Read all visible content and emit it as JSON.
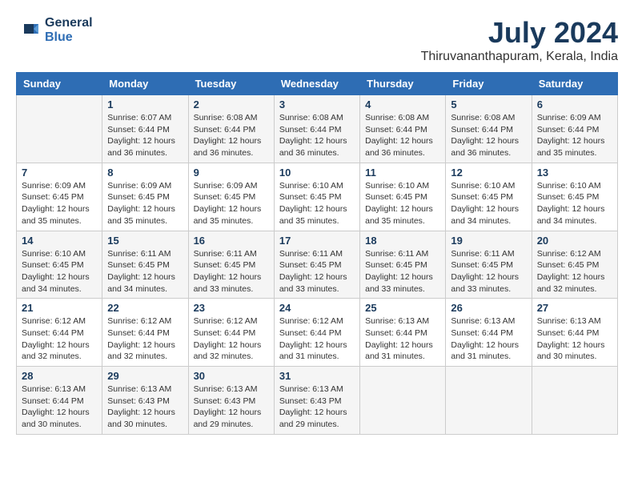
{
  "header": {
    "logo_general": "General",
    "logo_blue": "Blue",
    "month_title": "July 2024",
    "location": "Thiruvananthapuram, Kerala, India"
  },
  "days_of_week": [
    "Sunday",
    "Monday",
    "Tuesday",
    "Wednesday",
    "Thursday",
    "Friday",
    "Saturday"
  ],
  "weeks": [
    [
      {
        "day": "",
        "info": ""
      },
      {
        "day": "1",
        "info": "Sunrise: 6:07 AM\nSunset: 6:44 PM\nDaylight: 12 hours\nand 36 minutes."
      },
      {
        "day": "2",
        "info": "Sunrise: 6:08 AM\nSunset: 6:44 PM\nDaylight: 12 hours\nand 36 minutes."
      },
      {
        "day": "3",
        "info": "Sunrise: 6:08 AM\nSunset: 6:44 PM\nDaylight: 12 hours\nand 36 minutes."
      },
      {
        "day": "4",
        "info": "Sunrise: 6:08 AM\nSunset: 6:44 PM\nDaylight: 12 hours\nand 36 minutes."
      },
      {
        "day": "5",
        "info": "Sunrise: 6:08 AM\nSunset: 6:44 PM\nDaylight: 12 hours\nand 36 minutes."
      },
      {
        "day": "6",
        "info": "Sunrise: 6:09 AM\nSunset: 6:44 PM\nDaylight: 12 hours\nand 35 minutes."
      }
    ],
    [
      {
        "day": "7",
        "info": "Sunrise: 6:09 AM\nSunset: 6:45 PM\nDaylight: 12 hours\nand 35 minutes."
      },
      {
        "day": "8",
        "info": "Sunrise: 6:09 AM\nSunset: 6:45 PM\nDaylight: 12 hours\nand 35 minutes."
      },
      {
        "day": "9",
        "info": "Sunrise: 6:09 AM\nSunset: 6:45 PM\nDaylight: 12 hours\nand 35 minutes."
      },
      {
        "day": "10",
        "info": "Sunrise: 6:10 AM\nSunset: 6:45 PM\nDaylight: 12 hours\nand 35 minutes."
      },
      {
        "day": "11",
        "info": "Sunrise: 6:10 AM\nSunset: 6:45 PM\nDaylight: 12 hours\nand 35 minutes."
      },
      {
        "day": "12",
        "info": "Sunrise: 6:10 AM\nSunset: 6:45 PM\nDaylight: 12 hours\nand 34 minutes."
      },
      {
        "day": "13",
        "info": "Sunrise: 6:10 AM\nSunset: 6:45 PM\nDaylight: 12 hours\nand 34 minutes."
      }
    ],
    [
      {
        "day": "14",
        "info": "Sunrise: 6:10 AM\nSunset: 6:45 PM\nDaylight: 12 hours\nand 34 minutes."
      },
      {
        "day": "15",
        "info": "Sunrise: 6:11 AM\nSunset: 6:45 PM\nDaylight: 12 hours\nand 34 minutes."
      },
      {
        "day": "16",
        "info": "Sunrise: 6:11 AM\nSunset: 6:45 PM\nDaylight: 12 hours\nand 33 minutes."
      },
      {
        "day": "17",
        "info": "Sunrise: 6:11 AM\nSunset: 6:45 PM\nDaylight: 12 hours\nand 33 minutes."
      },
      {
        "day": "18",
        "info": "Sunrise: 6:11 AM\nSunset: 6:45 PM\nDaylight: 12 hours\nand 33 minutes."
      },
      {
        "day": "19",
        "info": "Sunrise: 6:11 AM\nSunset: 6:45 PM\nDaylight: 12 hours\nand 33 minutes."
      },
      {
        "day": "20",
        "info": "Sunrise: 6:12 AM\nSunset: 6:45 PM\nDaylight: 12 hours\nand 32 minutes."
      }
    ],
    [
      {
        "day": "21",
        "info": "Sunrise: 6:12 AM\nSunset: 6:44 PM\nDaylight: 12 hours\nand 32 minutes."
      },
      {
        "day": "22",
        "info": "Sunrise: 6:12 AM\nSunset: 6:44 PM\nDaylight: 12 hours\nand 32 minutes."
      },
      {
        "day": "23",
        "info": "Sunrise: 6:12 AM\nSunset: 6:44 PM\nDaylight: 12 hours\nand 32 minutes."
      },
      {
        "day": "24",
        "info": "Sunrise: 6:12 AM\nSunset: 6:44 PM\nDaylight: 12 hours\nand 31 minutes."
      },
      {
        "day": "25",
        "info": "Sunrise: 6:13 AM\nSunset: 6:44 PM\nDaylight: 12 hours\nand 31 minutes."
      },
      {
        "day": "26",
        "info": "Sunrise: 6:13 AM\nSunset: 6:44 PM\nDaylight: 12 hours\nand 31 minutes."
      },
      {
        "day": "27",
        "info": "Sunrise: 6:13 AM\nSunset: 6:44 PM\nDaylight: 12 hours\nand 30 minutes."
      }
    ],
    [
      {
        "day": "28",
        "info": "Sunrise: 6:13 AM\nSunset: 6:44 PM\nDaylight: 12 hours\nand 30 minutes."
      },
      {
        "day": "29",
        "info": "Sunrise: 6:13 AM\nSunset: 6:43 PM\nDaylight: 12 hours\nand 30 minutes."
      },
      {
        "day": "30",
        "info": "Sunrise: 6:13 AM\nSunset: 6:43 PM\nDaylight: 12 hours\nand 29 minutes."
      },
      {
        "day": "31",
        "info": "Sunrise: 6:13 AM\nSunset: 6:43 PM\nDaylight: 12 hours\nand 29 minutes."
      },
      {
        "day": "",
        "info": ""
      },
      {
        "day": "",
        "info": ""
      },
      {
        "day": "",
        "info": ""
      }
    ]
  ]
}
